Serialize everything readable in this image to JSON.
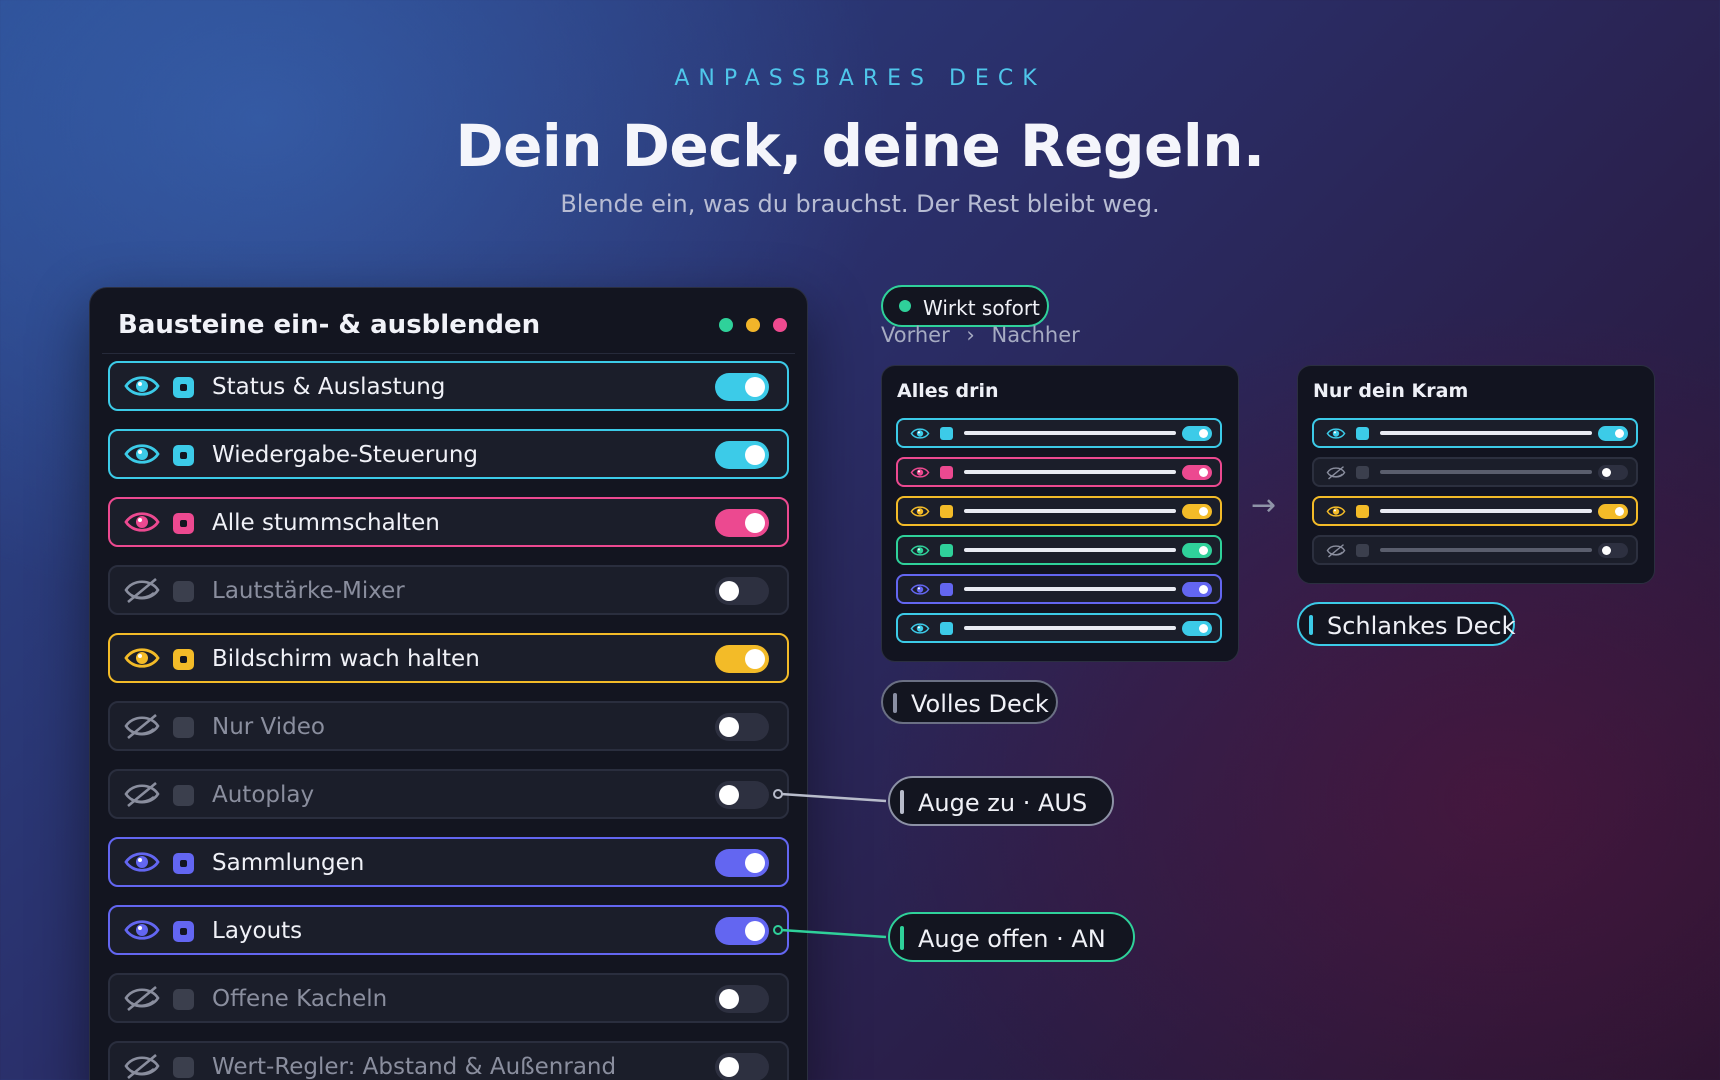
{
  "hero": {
    "eyebrow": "ANPASSBARES DECK",
    "headline": "Dein Deck, deine Regeln.",
    "subline": "Blende ein, was du brauchst. Der Rest bleibt weg."
  },
  "panel": {
    "title": "Bausteine ein- & ausblenden",
    "window_dots": [
      "#2fd19a",
      "#f2b52a",
      "#ee4a8f"
    ],
    "rows": [
      {
        "label": "Status & Auslastung",
        "on": true,
        "color": "#3ccbe8"
      },
      {
        "label": "Wiedergabe-Steuerung",
        "on": true,
        "color": "#3ccbe8"
      },
      {
        "label": "Alle stummschalten",
        "on": true,
        "color": "#ec4990"
      },
      {
        "label": "Lautstärke-Mixer",
        "on": false,
        "color": "#3b3f4d"
      },
      {
        "label": "Bildschirm wach halten",
        "on": true,
        "color": "#f3bb28"
      },
      {
        "label": "Nur Video",
        "on": false,
        "color": "#3b3f4d"
      },
      {
        "label": "Autoplay",
        "on": false,
        "color": "#3b3f4d"
      },
      {
        "label": "Sammlungen",
        "on": true,
        "color": "#6366f1"
      },
      {
        "label": "Layouts",
        "on": true,
        "color": "#6366f1"
      },
      {
        "label": "Offene Kacheln",
        "on": false,
        "color": "#3b3f4d"
      },
      {
        "label": "Wert-Regler: Abstand & Außenrand",
        "on": false,
        "color": "#3b3f4d"
      }
    ]
  },
  "badge": {
    "label": "Wirkt sofort",
    "color": "#2fd19a"
  },
  "flow": {
    "before": "Vorher",
    "separator": "›",
    "after": "Nachher"
  },
  "cards": {
    "full": {
      "title": "Alles drin",
      "rows": [
        {
          "on": true,
          "color": "#3ccbe8"
        },
        {
          "on": true,
          "color": "#ec4990"
        },
        {
          "on": true,
          "color": "#f3bb28"
        },
        {
          "on": true,
          "color": "#2fd19a"
        },
        {
          "on": true,
          "color": "#6366f1"
        },
        {
          "on": true,
          "color": "#3ccbe8"
        }
      ],
      "tag": "Volles Deck"
    },
    "slim": {
      "title": "Nur dein Kram",
      "rows": [
        {
          "on": true,
          "color": "#3ccbe8"
        },
        {
          "on": false,
          "color": "#3b3f4d"
        },
        {
          "on": true,
          "color": "#f3bb28"
        },
        {
          "on": false,
          "color": "#3b3f4d"
        }
      ],
      "tag": "Schlankes Deck"
    },
    "arrow": "→"
  },
  "callouts": {
    "closed": {
      "label": "Auge zu  ·  AUS",
      "color": "#b8bccb"
    },
    "open": {
      "label": "Auge offen  ·  AN",
      "color": "#2fd19a"
    }
  }
}
